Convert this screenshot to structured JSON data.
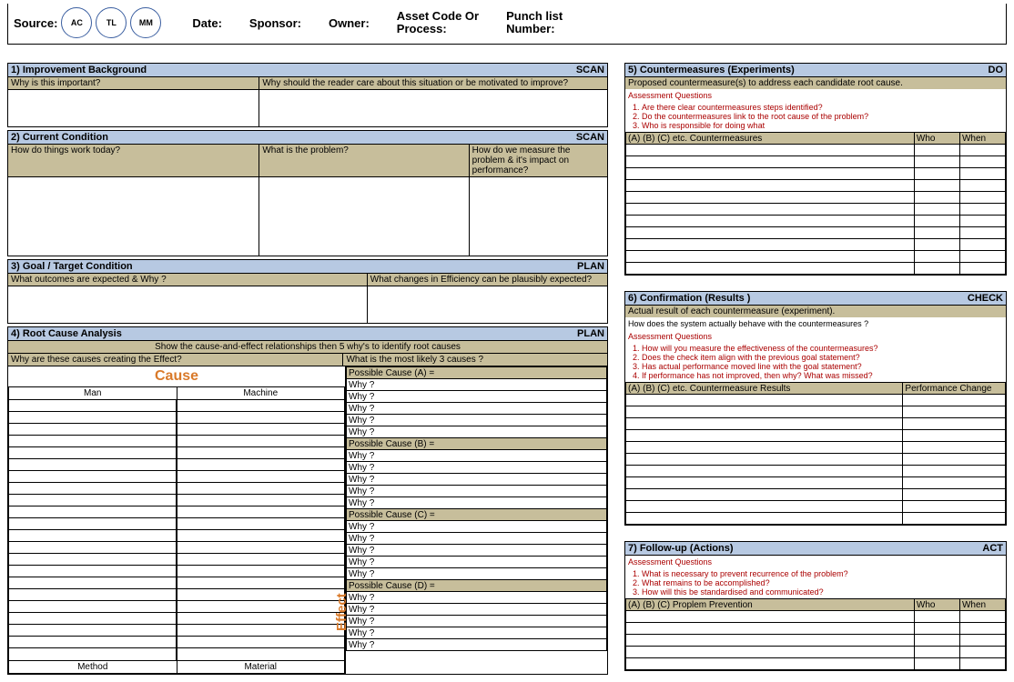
{
  "topbar": {
    "source_label": "Source:",
    "circles": [
      "AC",
      "TL",
      "MM"
    ],
    "date_label": "Date:",
    "sponsor_label": "Sponsor:",
    "owner_label": "Owner:",
    "asset_label_line1": "Asset Code  Or",
    "asset_label_line2": "Process:",
    "punch_label_line1": "Punch list",
    "punch_label_line2": "Number:"
  },
  "left": {
    "s1": {
      "title": "1) Improvement Background",
      "tag": "SCAN",
      "q1": "Why is this important?",
      "q2": "Why should the reader care about this situation or be motivated to improve?"
    },
    "s2": {
      "title": "2) Current Condition",
      "tag": "SCAN",
      "q1": "How do things work today?",
      "q2": "What is the problem?",
      "q3": "How do we measure the problem & it's impact on performance?"
    },
    "s3": {
      "title": "3) Goal / Target Condition",
      "tag": "PLAN",
      "q1": "What outcomes are expected & Why ?",
      "q2": "What changes in Efficiency can be plausibly expected?"
    },
    "s4": {
      "title": "4) Root Cause Analysis",
      "tag": "PLAN",
      "center_note": "Show the cause-and-effect relationships then 5 why's to identify root causes",
      "q_left": "Why are these causes creating the Effect?",
      "q_right": "What is the most likely 3 causes ?",
      "cause_label": "Cause",
      "effect_label": "Effect",
      "fish_top": [
        "Man",
        "Machine"
      ],
      "fish_bottom": [
        "Method",
        "Material"
      ],
      "causes": [
        {
          "label": "Possible Cause (A) =",
          "whys": [
            "Why ?",
            "Why ?",
            "Why ?",
            "Why ?",
            "Why ?"
          ]
        },
        {
          "label": "Possible Cause (B) =",
          "whys": [
            "Why ?",
            "Why ?",
            "Why ?",
            "Why ?",
            "Why ?"
          ]
        },
        {
          "label": "Possible Cause (C) =",
          "whys": [
            "Why ?",
            "Why ?",
            "Why ?",
            "Why ?",
            "Why ?"
          ]
        },
        {
          "label": "Possible Cause (D) =",
          "whys": [
            "Why ?",
            "Why ?",
            "Why ?",
            "Why ?",
            "Why ?"
          ]
        }
      ]
    }
  },
  "right": {
    "s5": {
      "title": "5) Countermeasures (Experiments)",
      "tag": "DO",
      "sub": "Proposed countermeasure(s) to address each candidate root cause.",
      "assess_title": "Assessment Questions",
      "assess": [
        "Are there clear countermeasures steps identified?",
        "Do the countermeasures link to the root cause of the problem?",
        "Who is responsible for doing what"
      ],
      "col_main": "(A) (B) (C)  etc. Countermeasures",
      "col_who": "Who",
      "col_when": "When",
      "rows": 11
    },
    "s6": {
      "title": "6) Confirmation (Results )",
      "tag": "CHECK",
      "sub": "Actual result of each countermeasure (experiment).",
      "note": "How does the system actually behave with the countermeasures ?",
      "assess_title": "Assessment Questions",
      "assess": [
        "How will you measure the effectiveness of the countermeasures?",
        "Does the check item align with the previous goal statement?",
        "Has actual performance moved line with the goal statement?",
        "If performance has not improved, then why? What was missed?"
      ],
      "col_main": "(A) (B) (C)  etc. Countermeasure Results",
      "col_perf": "Performance Change",
      "rows": 11
    },
    "s7": {
      "title": "7) Follow-up (Actions)",
      "tag": "ACT",
      "assess_title": "Assessment Questions",
      "assess": [
        "What is necessary to prevent recurrence of the problem?",
        "What remains to be accomplished?",
        "How will this be standardised and communicated?"
      ],
      "col_main": "(A) (B) (C) Proplem Prevention",
      "col_who": "Who",
      "col_when": "When",
      "rows": 5
    }
  }
}
